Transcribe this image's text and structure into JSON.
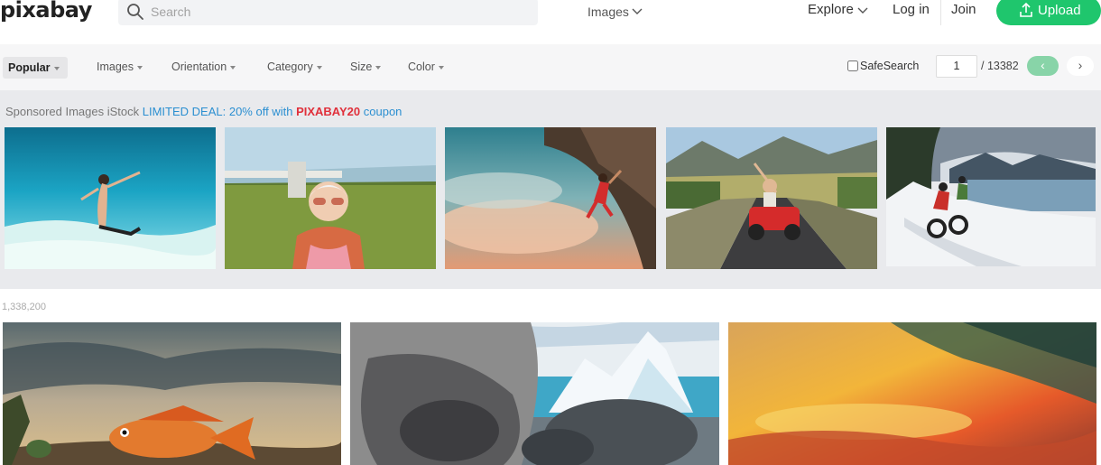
{
  "header": {
    "logo": "pixabay",
    "search_placeholder": "Search",
    "search_type": "Images",
    "explore": "Explore",
    "login": "Log in",
    "join": "Join",
    "upload": "Upload"
  },
  "filters": {
    "popular": "Popular",
    "items": [
      "Images",
      "Orientation",
      "Category",
      "Size",
      "Color"
    ],
    "safesearch": "SafeSearch",
    "page": "1",
    "total_pages": "/ 13382",
    "prev": "‹",
    "next": "›"
  },
  "sponsored": {
    "prefix": "Sponsored Images iStock",
    "deal": "LIMITED DEAL: 20% off with",
    "code": "PIXABAY20",
    "suffix": "coupon"
  },
  "results": {
    "count": "1,338,200"
  },
  "icons": {
    "search": "search-icon",
    "upload": "upload-icon",
    "chevron": "chevron-down-icon"
  },
  "colors": {
    "brand_green": "#1fc66d",
    "deal_blue": "#2b8fd1",
    "code_red": "#e0303b"
  }
}
